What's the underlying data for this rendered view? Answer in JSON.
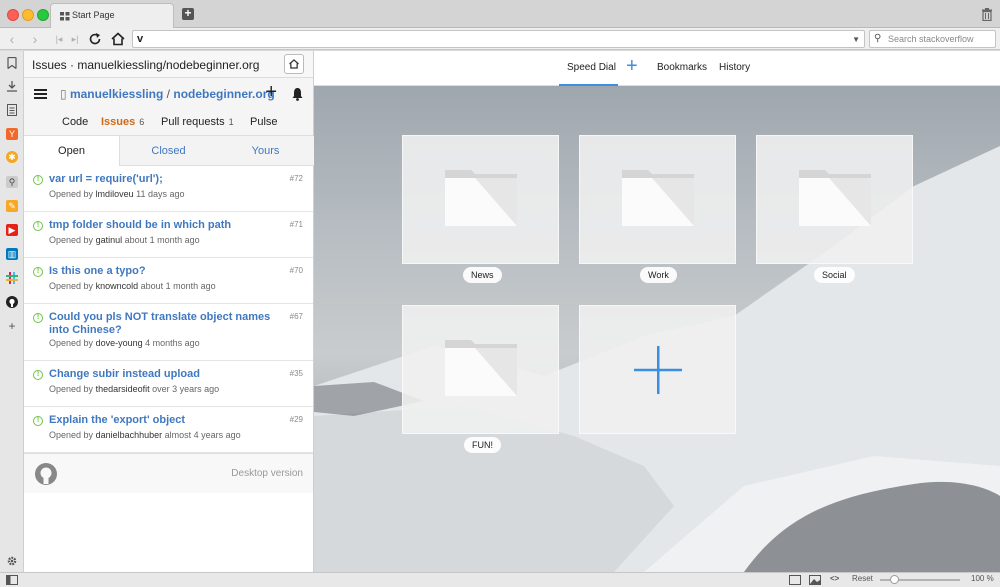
{
  "browser": {
    "tab_title": "Start Page",
    "url_text": "v",
    "search_placeholder": "Search stackoverflow"
  },
  "panel": {
    "title": "Issues · manuelkiessling/nodebeginner.org",
    "repo_owner": "manuelkiessling",
    "repo_sep": "/",
    "repo_name": "nodebeginner.org",
    "tabs": [
      {
        "label": "Code",
        "count": ""
      },
      {
        "label": "Issues",
        "count": "6"
      },
      {
        "label": "Pull requests",
        "count": "1"
      },
      {
        "label": "Pulse",
        "count": ""
      }
    ],
    "filters": {
      "open": "Open",
      "closed": "Closed",
      "yours": "Yours"
    },
    "issues": [
      {
        "title": "var url = require('url');",
        "num": "#72",
        "opened_by": "Opened by",
        "author": "lmdiloveu",
        "when": "11 days ago"
      },
      {
        "title": "tmp folder should be in which path",
        "num": "#71",
        "opened_by": "Opened by",
        "author": "gatinul",
        "when": "about 1 month ago"
      },
      {
        "title": "Is this one a typo?",
        "num": "#70",
        "opened_by": "Opened by",
        "author": "knowncold",
        "when": "about 1 month ago"
      },
      {
        "title": "Could you pls NOT translate object names into Chinese?",
        "num": "#67",
        "opened_by": "Opened by",
        "author": "dove-young",
        "when": "4 months ago"
      },
      {
        "title": "Change subir instead upload",
        "num": "#35",
        "opened_by": "Opened by",
        "author": "thedarsideofit",
        "when": "over 3 years ago"
      },
      {
        "title": "Explain the 'export' object",
        "num": "#29",
        "opened_by": "Opened by",
        "author": "danielbachhuber",
        "when": "almost 4 years ago"
      }
    ],
    "desktop_version": "Desktop version"
  },
  "speed_dial": {
    "nav": {
      "speed_dial": "Speed Dial",
      "bookmarks": "Bookmarks",
      "history": "History"
    },
    "tiles": [
      {
        "label": "News"
      },
      {
        "label": "Work"
      },
      {
        "label": "Social"
      },
      {
        "label": "FUN!"
      }
    ]
  },
  "statusbar": {
    "reset": "Reset",
    "zoom": "100 %"
  },
  "colors": {
    "accent_blue": "#3b8ee0",
    "github_link": "#4078c0",
    "github_orange": "#d26911",
    "issue_open_green": "#6cc644"
  }
}
